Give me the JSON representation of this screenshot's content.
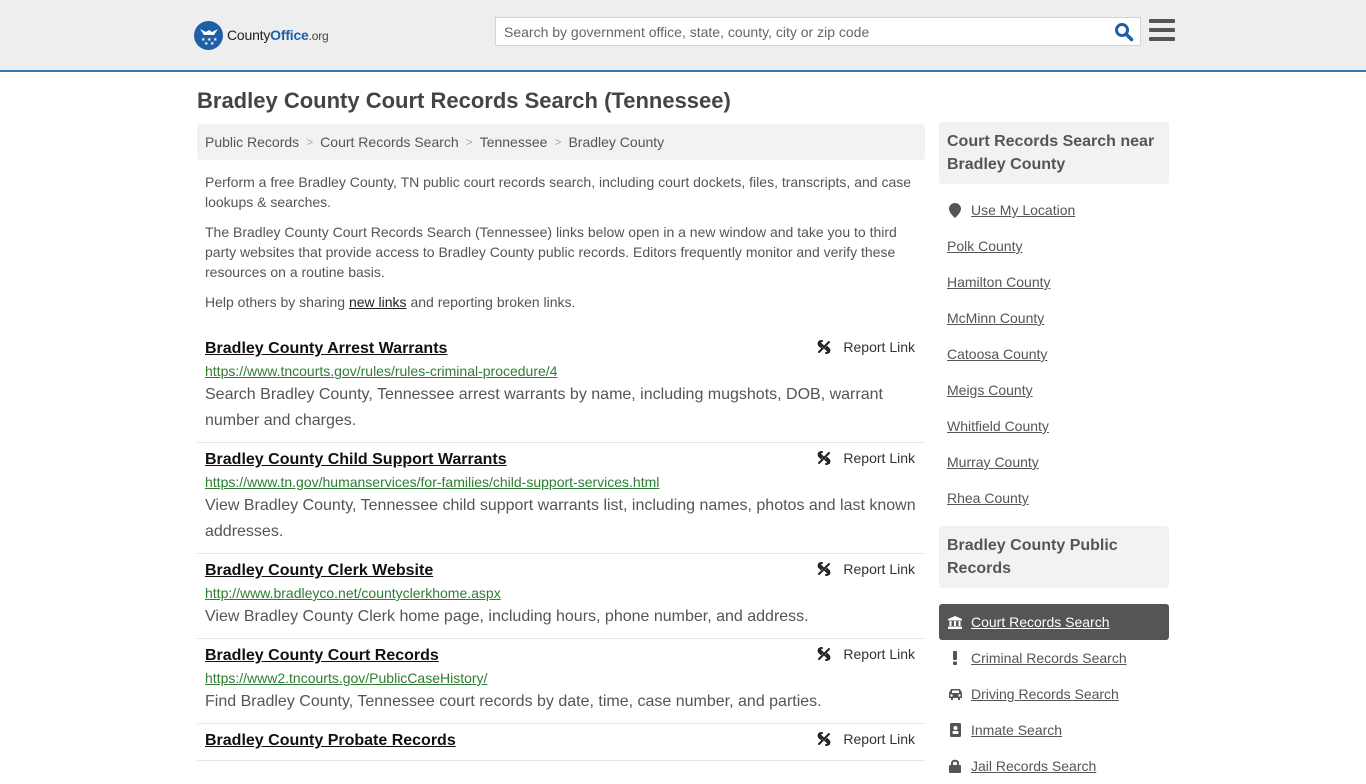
{
  "header": {
    "logo_county": "County",
    "logo_office": "Office",
    "logo_org": ".org",
    "search_placeholder": "Search by government office, state, county, city or zip code",
    "search_value": ""
  },
  "page_title": "Bradley County Court Records Search (Tennessee)",
  "breadcrumb": [
    "Public Records",
    "Court Records Search",
    "Tennessee",
    "Bradley County"
  ],
  "intro": {
    "p1": "Perform a free Bradley County, TN public court records search, including court dockets, files, transcripts, and case lookups & searches.",
    "p2": "The Bradley County Court Records Search (Tennessee) links below open in a new window and take you to third party websites that provide access to Bradley County public records. Editors frequently monitor and verify these resources on a routine basis.",
    "p3_before": "Help others by sharing ",
    "p3_link": "new links",
    "p3_after": " and reporting broken links."
  },
  "report_label": "Report Link",
  "results": [
    {
      "title": "Bradley County Arrest Warrants",
      "url": "https://www.tncourts.gov/rules/rules-criminal-procedure/4",
      "desc": "Search Bradley County, Tennessee arrest warrants by name, including mugshots, DOB, warrant number and charges."
    },
    {
      "title": "Bradley County Child Support Warrants",
      "url": "https://www.tn.gov/humanservices/for-families/child-support-services.html",
      "desc": "View Bradley County, Tennessee child support warrants list, including names, photos and last known addresses."
    },
    {
      "title": "Bradley County Clerk Website",
      "url": "http://www.bradleyco.net/countyclerkhome.aspx",
      "desc": "View Bradley County Clerk home page, including hours, phone number, and address."
    },
    {
      "title": "Bradley County Court Records",
      "url": "https://www2.tncourts.gov/PublicCaseHistory/",
      "desc": "Find Bradley County, Tennessee court records by date, time, case number, and parties."
    },
    {
      "title": "Bradley County Probate Records",
      "url": "",
      "desc": ""
    }
  ],
  "sidebar": {
    "nearby_title": "Court Records Search near Bradley County",
    "use_location": "Use My Location",
    "nearby": [
      "Polk County",
      "Hamilton County",
      "McMinn County",
      "Catoosa County",
      "Meigs County",
      "Whitfield County",
      "Murray County",
      "Rhea County"
    ],
    "public_records_title": "Bradley County Public Records",
    "nav": [
      {
        "label": "Court Records Search",
        "icon": "courthouse-icon",
        "active": true
      },
      {
        "label": "Criminal Records Search",
        "icon": "exclamation-icon",
        "active": false
      },
      {
        "label": "Driving Records Search",
        "icon": "car-icon",
        "active": false
      },
      {
        "label": "Inmate Search",
        "icon": "id-badge-icon",
        "active": false
      },
      {
        "label": "Jail Records Search",
        "icon": "lock-icon",
        "active": false
      }
    ]
  },
  "colors": {
    "accent": "#3277b6",
    "brand": "#1f5fa8",
    "url_green": "#2e7d32",
    "active_nav": "#555555"
  }
}
